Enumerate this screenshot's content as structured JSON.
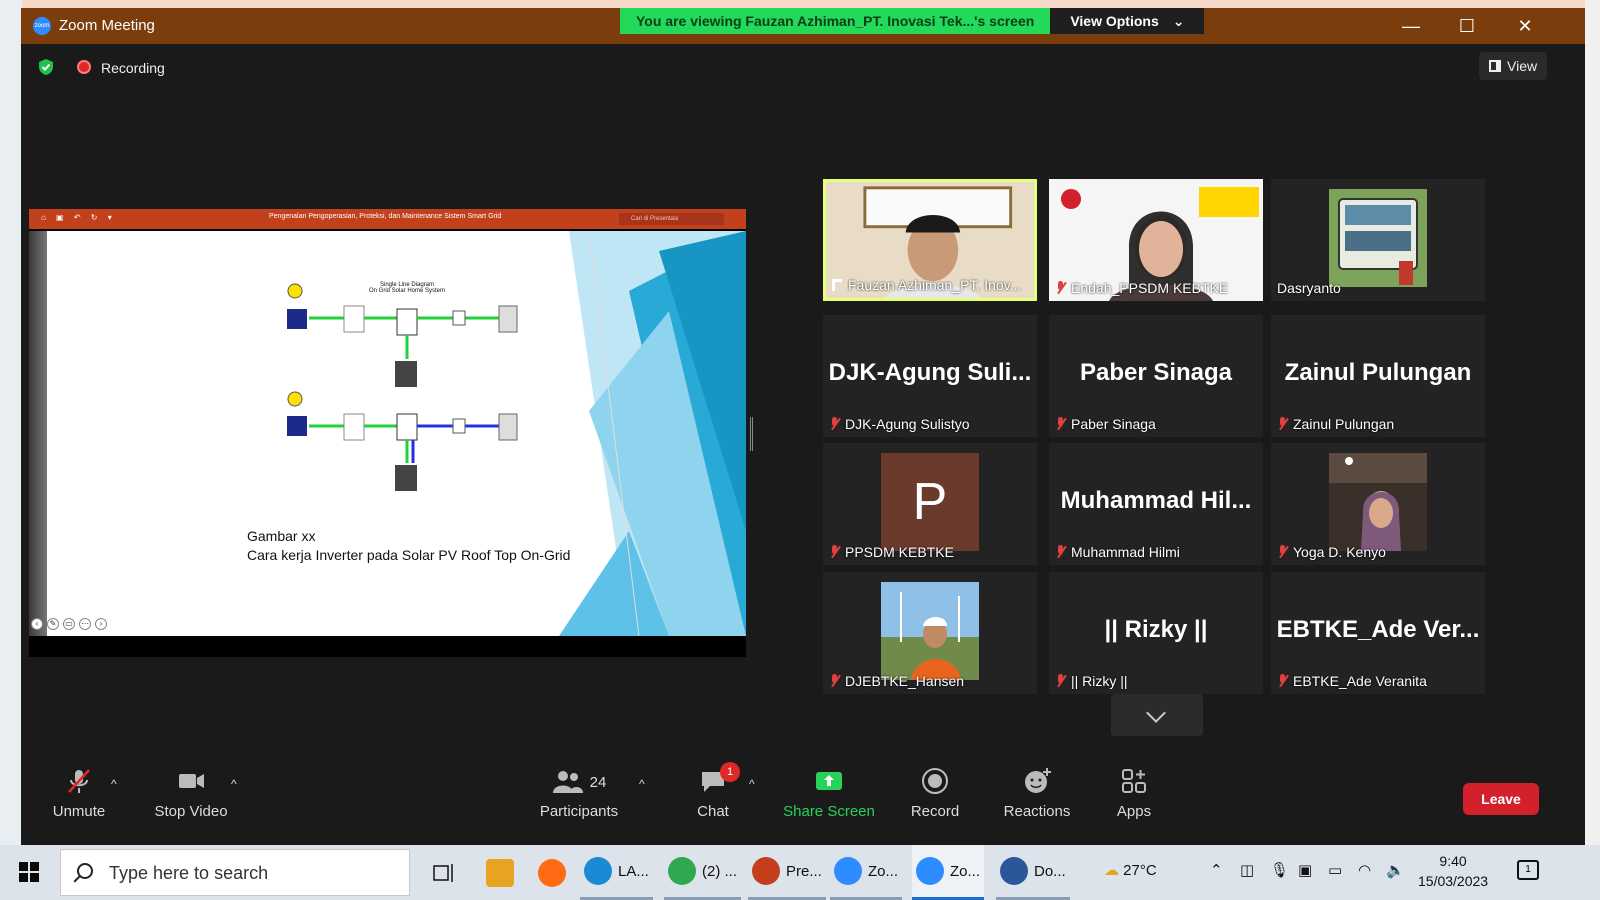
{
  "window": {
    "title": "Zoom Meeting",
    "app_icon_text": "zoom",
    "banner_text": "You are viewing Fauzan Azhiman_PT. Inovasi Tek...'s screen",
    "view_options_label": "View Options",
    "minimize": "—",
    "maximize": "☐",
    "close": "✕"
  },
  "topbar": {
    "recording_label": "Recording",
    "view_label": "View"
  },
  "shared_screen": {
    "ppt_title": "Pengenalan Pengoperasian, Proteksi, dan Maintenance Sistem Smart Grid",
    "ppt_search_placeholder": "Cari di Presentasi",
    "diagram_title_line1": "Single Line Diagram",
    "diagram_title_line2": "On Grid Solar Home System",
    "caption_line1": "Gambar xx",
    "caption_line2": "Cara kerja Inverter pada Solar PV Roof Top On-Grid"
  },
  "participants": [
    {
      "display": "",
      "label": "Fauzan Azhiman_PT. Inov...",
      "video": true,
      "active": true,
      "pinned": true
    },
    {
      "display": "",
      "label": "Endah_PPSDM KEBTKE",
      "video": true,
      "muted": true
    },
    {
      "display": "",
      "label": "Dasryanto",
      "video": true
    },
    {
      "display": "DJK-Agung  Suli...",
      "label": "DJK-Agung Sulistyo",
      "muted": true
    },
    {
      "display": "Paber Sinaga",
      "label": "Paber Sinaga",
      "muted": true
    },
    {
      "display": "Zainul Pulungan",
      "label": "Zainul Pulungan",
      "muted": true
    },
    {
      "display": "P",
      "label": "PPSDM KEBTKE",
      "muted": true,
      "avatar": true
    },
    {
      "display": "Muhammad  Hil...",
      "label": "Muhammad Hilmi",
      "muted": true
    },
    {
      "display": "",
      "label": "Yoga D. Kenyo",
      "video": true,
      "muted": true
    },
    {
      "display": "",
      "label": "DJEBTKE_Hansen",
      "video": true,
      "muted": true
    },
    {
      "display": "|| Rizky ||",
      "label": "|| Rizky ||",
      "muted": true
    },
    {
      "display": "EBTKE_Ade  Ver...",
      "label": "EBTKE_Ade Veranita",
      "muted": true
    }
  ],
  "toolbar": {
    "unmute": "Unmute",
    "stop_video": "Stop Video",
    "participants": "Participants",
    "participants_count": "24",
    "chat": "Chat",
    "chat_badge": "1",
    "share_screen": "Share Screen",
    "record": "Record",
    "reactions": "Reactions",
    "apps": "Apps",
    "leave": "Leave"
  },
  "taskbar": {
    "search_placeholder": "Type here to search",
    "apps": [
      {
        "label": "",
        "color": "#e8a320"
      },
      {
        "label": "",
        "color": "#ff6a13"
      },
      {
        "label": "LA...",
        "color": "#1b8ad6"
      },
      {
        "label": "(2) ...",
        "color": "#2fa84f"
      },
      {
        "label": "Pre...",
        "color": "#c43e1c"
      },
      {
        "label": "Zo...",
        "color": "#2d8cff"
      },
      {
        "label": "Zo...",
        "color": "#2d8cff"
      },
      {
        "label": "Do...",
        "color": "#2b579a"
      }
    ],
    "weather": "27°C",
    "time": "9:40",
    "date": "15/03/2023",
    "notifications": "1"
  },
  "colors": {
    "titlebar": "#7a3d0b",
    "banner_green": "#23d959",
    "leave_red": "#d3212b",
    "share_green": "#26d35a"
  }
}
